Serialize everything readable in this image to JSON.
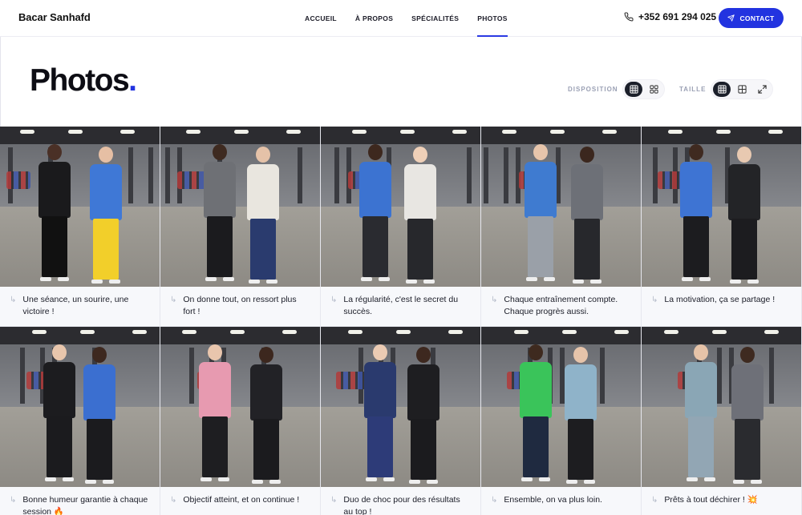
{
  "header": {
    "brand": "Bacar Sanhafd",
    "nav": [
      {
        "label": "ACCUEIL",
        "active": false
      },
      {
        "label": "À PROPOS",
        "active": false
      },
      {
        "label": "SPÉCIALITÉS",
        "active": false
      },
      {
        "label": "PHOTOS",
        "active": true
      }
    ],
    "phone": "+352 691 294 025",
    "contact_label": "CONTACT",
    "accent_color": "#2233e0"
  },
  "page": {
    "title": "Photos",
    "title_dot": ".",
    "layout_label": "DISPOSITION",
    "size_label": "TAILLE",
    "layout_options": [
      {
        "icon": "grid-dense-icon",
        "active": true
      },
      {
        "icon": "grid-4-icon",
        "active": false
      }
    ],
    "size_options": [
      {
        "icon": "grid-dense-icon",
        "active": true
      },
      {
        "icon": "grid-4-icon",
        "active": false
      },
      {
        "icon": "expand-icon",
        "active": false
      }
    ]
  },
  "photos": [
    {
      "caption": "Une séance, un sourire, une victoire !",
      "icon": "corner-arrow-icon"
    },
    {
      "caption": "On donne tout, on ressort plus fort !",
      "icon": "corner-arrow-icon"
    },
    {
      "caption": "La régularité, c'est le secret du succès.",
      "icon": "corner-arrow-icon"
    },
    {
      "caption": "Chaque entraînement compte. Chaque progrès aussi.",
      "icon": "corner-arrow-icon"
    },
    {
      "caption": "La motivation, ça se partage !",
      "icon": "corner-arrow-icon"
    },
    {
      "caption": "Bonne humeur garantie à chaque session 🔥",
      "icon": "corner-arrow-icon"
    },
    {
      "caption": "Objectif atteint, et on continue !",
      "icon": "corner-arrow-icon"
    },
    {
      "caption": "Duo de choc pour des résultats au top !",
      "icon": "corner-arrow-icon"
    },
    {
      "caption": "Ensemble, on va plus loin.",
      "icon": "corner-arrow-icon"
    },
    {
      "caption": "Prêts à tout déchirer ! 💥",
      "icon": "corner-arrow-icon"
    }
  ]
}
